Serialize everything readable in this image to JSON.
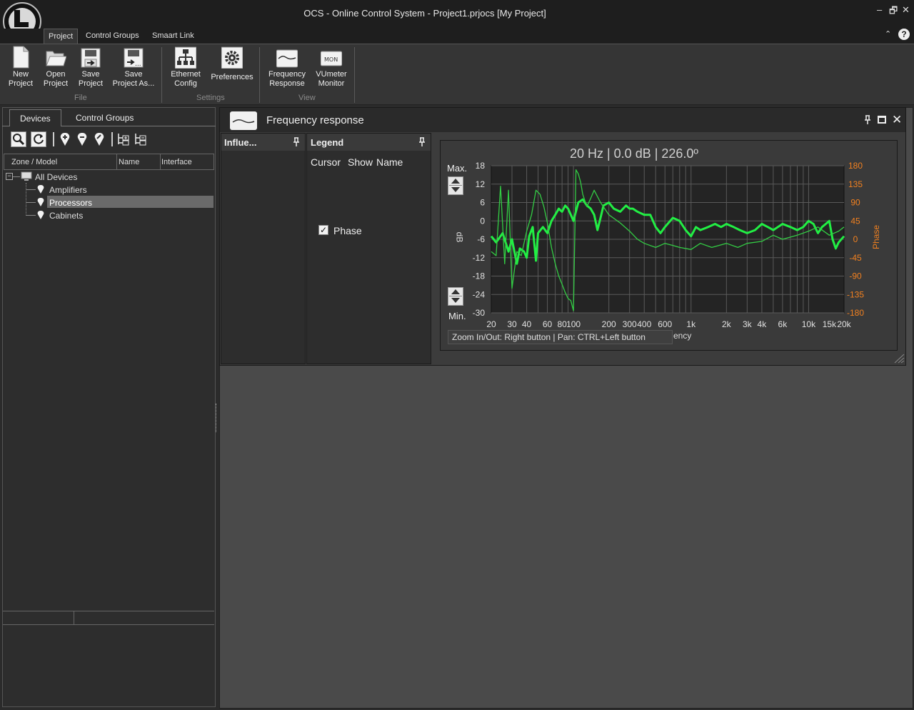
{
  "window": {
    "title": "OCS - Online Control System - Project1.prjocs [My Project]",
    "controls": {
      "minimize": "–",
      "restore": "🗗",
      "close": "✕"
    }
  },
  "ribbon_tabs": [
    {
      "label": "Project",
      "active": true
    },
    {
      "label": "Control Groups",
      "active": false
    },
    {
      "label": "Smaart Link",
      "active": false
    }
  ],
  "ribbon": {
    "groups": [
      {
        "label": "File",
        "buttons": [
          {
            "l1": "New",
            "l2": "Project",
            "icon": "new-project-icon"
          },
          {
            "l1": "Open",
            "l2": "Project",
            "icon": "open-folder-icon"
          },
          {
            "l1": "Save",
            "l2": "Project",
            "icon": "save-icon"
          },
          {
            "l1": "Save",
            "l2": "Project As...",
            "icon": "save-as-icon"
          }
        ]
      },
      {
        "label": "Settings",
        "buttons": [
          {
            "l1": "Ethernet",
            "l2": "Config",
            "icon": "network-icon"
          },
          {
            "l1": "Preferences",
            "l2": "",
            "icon": "gear-icon"
          }
        ]
      },
      {
        "label": "View",
        "buttons": [
          {
            "l1": "Frequency",
            "l2": "Response",
            "icon": "frequency-curve-icon"
          },
          {
            "l1": "VUmeter",
            "l2": "Monitor",
            "icon": "mon-icon",
            "icon_text": "MON"
          }
        ]
      }
    ]
  },
  "left_panel": {
    "tabs": [
      {
        "label": "Devices",
        "active": true
      },
      {
        "label": "Control Groups",
        "active": false
      }
    ],
    "columns": [
      "Zone / Model",
      "Name",
      "Interface"
    ],
    "tree": {
      "root": "All Devices",
      "children": [
        "Amplifiers",
        "Processors",
        "Cabinets"
      ],
      "selected": "Processors"
    }
  },
  "frequency_response": {
    "title": "Frequency response",
    "influences_label": "Influe...",
    "legend": {
      "title": "Legend",
      "columns": [
        "Cursor",
        "Show",
        "Name"
      ],
      "phase_label": "Phase",
      "phase_checked": true
    },
    "readout": "20 Hz | 0.0 dB | 226.0º",
    "max_label": "Max.",
    "min_label": "Min.",
    "left_axis_label": "dB",
    "right_axis_label": "Phase",
    "x_axis_partial_label": "ency",
    "hint": "Zoom In/Out: Right button | Pan: CTRL+Left button"
  },
  "chart_data": {
    "type": "line",
    "x_scale": "log",
    "xlim": [
      20,
      20000
    ],
    "ylim": [
      -30,
      18
    ],
    "y2lim": [
      -180,
      180
    ],
    "y_ticks": [
      18,
      12,
      6,
      0,
      -6,
      -12,
      -18,
      -24,
      -30
    ],
    "y2_ticks": [
      180,
      135,
      90,
      45,
      0,
      -45,
      -90,
      -135,
      -180
    ],
    "x_ticks": [
      {
        "v": 20,
        "t": "20"
      },
      {
        "v": 30,
        "t": "30"
      },
      {
        "v": 40,
        "t": "40"
      },
      {
        "v": 60,
        "t": "60"
      },
      {
        "v": 80,
        "t": "80"
      },
      {
        "v": 100,
        "t": "100"
      },
      {
        "v": 200,
        "t": "200"
      },
      {
        "v": 300,
        "t": "300"
      },
      {
        "v": 400,
        "t": "400"
      },
      {
        "v": 600,
        "t": "600"
      },
      {
        "v": 1000,
        "t": "1k"
      },
      {
        "v": 2000,
        "t": "2k"
      },
      {
        "v": 3000,
        "t": "3k"
      },
      {
        "v": 4000,
        "t": "4k"
      },
      {
        "v": 6000,
        "t": "6k"
      },
      {
        "v": 10000,
        "t": "10k"
      },
      {
        "v": 15000,
        "t": "15k"
      },
      {
        "v": 20000,
        "t": "20k"
      }
    ],
    "grid": true,
    "colors": {
      "magnitude": "#22ee44",
      "phase": "#33cc44",
      "right_axis": "#f08020"
    },
    "series": [
      {
        "axis": "y",
        "x": [
          20,
          22,
          25,
          28,
          30,
          33,
          35,
          38,
          40,
          42,
          45,
          48,
          50,
          55,
          60,
          65,
          70,
          75,
          80,
          85,
          90,
          95,
          100,
          110,
          120,
          130,
          140,
          150,
          160,
          170,
          180,
          200,
          220,
          250,
          280,
          300,
          320,
          350,
          400,
          450,
          500,
          550,
          600,
          700,
          800,
          900,
          1000,
          1100,
          1200,
          1400,
          1600,
          1800,
          2000,
          2300,
          2600,
          3000,
          3500,
          4000,
          4500,
          5000,
          6000,
          7000,
          8000,
          9000,
          10000,
          11000,
          12000,
          13000,
          14000,
          15000,
          16000,
          17000,
          18000,
          20000
        ],
        "y": [
          -5,
          -7,
          -4,
          -10,
          -6,
          -14,
          -9,
          -10,
          -12,
          -5,
          -2,
          -13,
          -4,
          -2,
          -4,
          0,
          2,
          4,
          3,
          5,
          4,
          2,
          0,
          6,
          7,
          5,
          4,
          2,
          -3,
          1,
          5,
          6,
          4,
          3,
          5,
          4,
          4,
          3,
          2,
          2,
          -2,
          -4,
          -2,
          1,
          0,
          -3,
          -5,
          -2,
          -3,
          -2,
          -1,
          -2,
          -1,
          -2,
          -3,
          -4,
          -3,
          -1,
          -2,
          -3,
          -1,
          -2,
          -3,
          -2,
          0,
          -1,
          -4,
          -2,
          -1,
          0,
          -6,
          -9,
          -7,
          -5
        ]
      },
      {
        "axis": "y2",
        "x": [
          20,
          22,
          24,
          26,
          28,
          30,
          33,
          36,
          40,
          44,
          48,
          52,
          56,
          60,
          65,
          70,
          75,
          80,
          85,
          90,
          95,
          100,
          105,
          110,
          115,
          120,
          130,
          140,
          150,
          170,
          200,
          250,
          300,
          350,
          400,
          500,
          600,
          700,
          800,
          1000,
          1200,
          1500,
          2000,
          2500,
          3000,
          4000,
          5000,
          6000,
          8000,
          10000,
          12000,
          15000,
          18000,
          20000
        ],
        "y": [
          -30,
          -40,
          130,
          -60,
          120,
          -120,
          -30,
          -40,
          20,
          60,
          120,
          110,
          80,
          40,
          -20,
          -60,
          -90,
          -110,
          -130,
          -145,
          -150,
          -175,
          170,
          160,
          140,
          110,
          80,
          100,
          120,
          90,
          60,
          40,
          20,
          0,
          -10,
          -20,
          -10,
          -15,
          -20,
          -25,
          -10,
          -20,
          -10,
          -20,
          -10,
          -5,
          10,
          0,
          10,
          20,
          30,
          10,
          20,
          30
        ]
      }
    ]
  }
}
